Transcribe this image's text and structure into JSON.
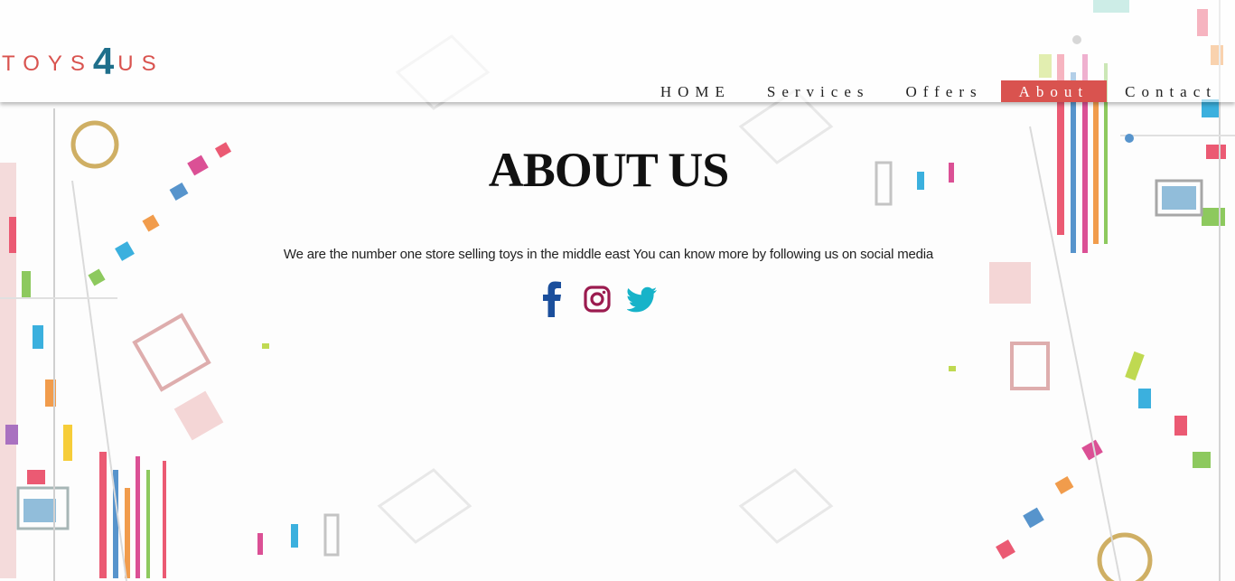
{
  "header": {
    "logo": {
      "part1": "TOYS",
      "part2": "4",
      "part3": "US"
    },
    "nav": [
      {
        "label": "HOME",
        "active": false
      },
      {
        "label": "Services",
        "active": false
      },
      {
        "label": "Offers",
        "active": false
      },
      {
        "label": "About",
        "active": true
      },
      {
        "label": "Contact",
        "active": false
      }
    ]
  },
  "main": {
    "title": "ABOUT US",
    "description": "We are the number one store selling toys in the middle east You can know more by following us on social media",
    "social": [
      {
        "icon": "facebook-icon",
        "color": "#1b4f9c"
      },
      {
        "icon": "instagram-icon",
        "color": "#9b1b4f"
      },
      {
        "icon": "twitter-icon",
        "color": "#17b3c9"
      }
    ]
  },
  "colors": {
    "accent": "#d9534f",
    "logo_number": "#1f6f8b"
  }
}
